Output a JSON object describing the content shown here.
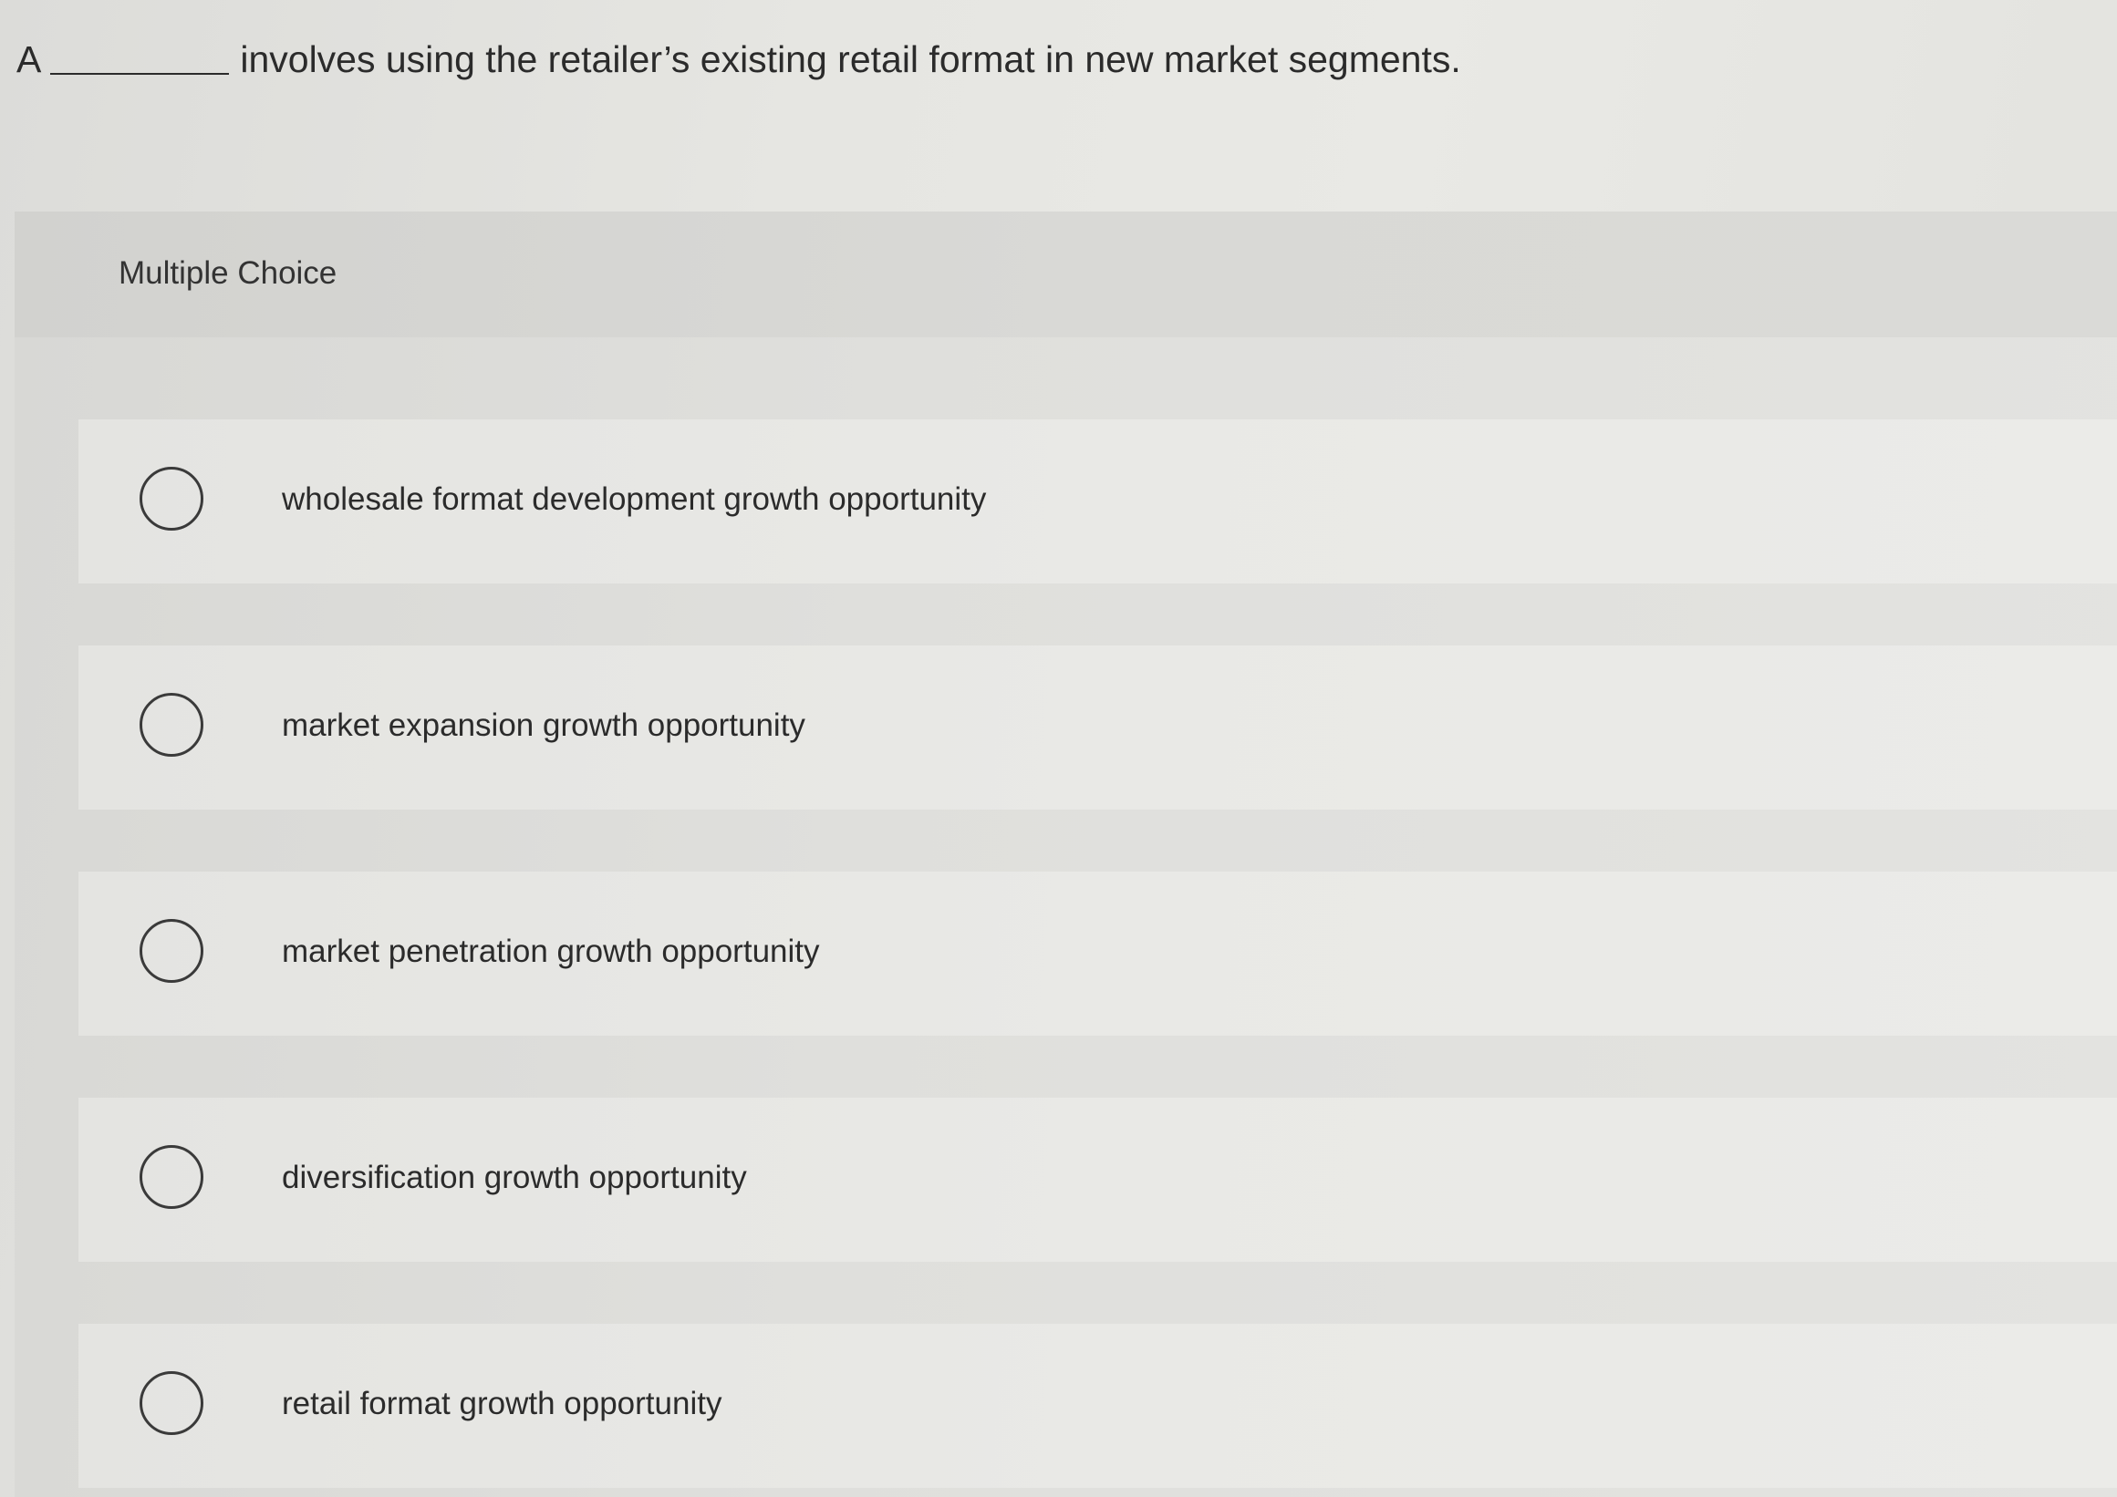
{
  "question": {
    "prefix": "A",
    "text": "involves using the retailer’s existing retail format in new market segments."
  },
  "panel": {
    "title": "Multiple Choice"
  },
  "options": [
    {
      "label": "wholesale format development growth opportunity"
    },
    {
      "label": "market expansion growth opportunity"
    },
    {
      "label": "market penetration growth opportunity"
    },
    {
      "label": "diversification growth opportunity"
    },
    {
      "label": "retail format growth opportunity"
    }
  ]
}
